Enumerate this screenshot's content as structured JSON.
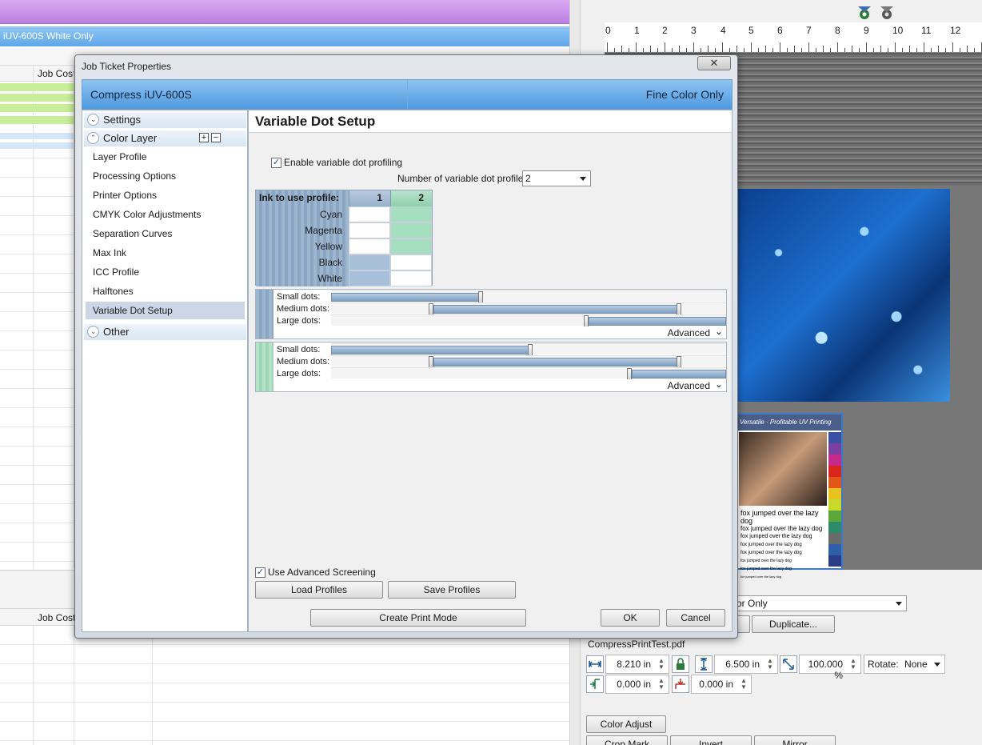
{
  "background_app": {
    "job_bar_label": "iUV-600S White Only",
    "column_job_cost": "Job Cost",
    "column_job_cost_lower": "Job Cost",
    "ruler_numbers": [
      "0",
      "1",
      "2",
      "3",
      "4",
      "5",
      "6",
      "7",
      "8",
      "9",
      "10",
      "11",
      "12"
    ],
    "test_page_header": "Versatile · Profitable UV Printing",
    "test_page_lines": [
      "fox jumped over the lazy dog",
      "fox jumped over the lazy dog",
      "fox jumped over the lazy dog",
      "fox jumped over the lazy dog",
      "fox jumped over the lazy dog",
      "fox jumped over the lazy dog",
      "fox jumped over the lazy dog",
      "fox jumped over the lazy dog"
    ],
    "mode_dropdown_value": "or Only",
    "duplicate_button": "Duplicate...",
    "file_name": "CompressPrintTest.pdf",
    "width_value": "8.210 in",
    "height_value": "6.500 in",
    "scale_value": "100.000 %",
    "rotate_label": "Rotate:",
    "rotate_value": "None",
    "offset_x_value": "0.000 in",
    "offset_y_value": "0.000 in",
    "color_adjust_button": "Color Adjust",
    "crop_mark_button": "Crop Mark",
    "invert_button": "Invert",
    "mirror_button": "Mirror"
  },
  "dialog": {
    "title": "Job Ticket Properties",
    "close_glyph": "✕",
    "printer_name": "Compress iUV-600S",
    "print_mode": "Fine Color Only",
    "nav": {
      "settings_label": "Settings",
      "color_layer_label": "Color Layer",
      "other_label": "Other",
      "items": [
        "Layer Profile",
        "Processing Options",
        "Printer Options",
        "CMYK Color Adjustments",
        "Separation Curves",
        "Max Ink",
        "ICC Profile",
        "Halftones",
        "Variable Dot Setup"
      ],
      "selected": "Variable Dot Setup"
    },
    "content": {
      "title": "Variable Dot Setup",
      "enable_label": "Enable variable dot profiling",
      "enable_checked": true,
      "num_profiles_label": "Number of variable dot profiles:",
      "num_profiles_value": "2",
      "ink_table": {
        "header": "Ink to use profile:",
        "columns": [
          "1",
          "2"
        ],
        "inks": [
          "Cyan",
          "Magenta",
          "Yellow",
          "Black",
          "White"
        ],
        "assignment": [
          "2",
          "2",
          "2",
          "1",
          "1"
        ]
      },
      "profiles": [
        {
          "labels": [
            "Small dots:",
            "Medium dots:",
            "Large dots:"
          ],
          "advanced_label": "Advanced",
          "color": "#9fb6cf"
        },
        {
          "labels": [
            "Small dots:",
            "Medium dots:",
            "Large dots:"
          ],
          "advanced_label": "Advanced",
          "color": "#a8dcc0"
        }
      ],
      "use_advanced_screening_label": "Use Advanced Screening",
      "use_advanced_screening_checked": true,
      "load_profiles": "Load Profiles",
      "save_profiles": "Save Profiles",
      "create_print_mode": "Create Print Mode",
      "ok": "OK",
      "cancel": "Cancel"
    }
  }
}
